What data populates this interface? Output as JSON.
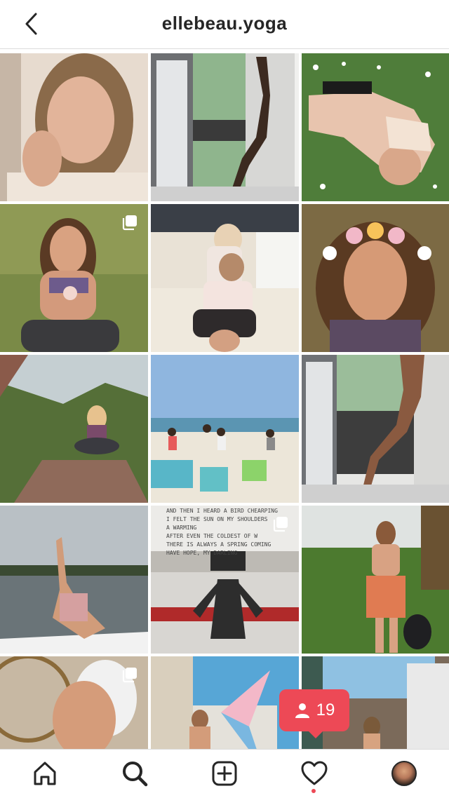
{
  "header": {
    "title": "ellebeau.yoga"
  },
  "posts": [
    {
      "desc": "portrait",
      "multi": false
    },
    {
      "desc": "yoga pose by window",
      "multi": false
    },
    {
      "desc": "lying on grass",
      "multi": false
    },
    {
      "desc": "sitting in grass",
      "multi": true
    },
    {
      "desc": "family yoga",
      "multi": false
    },
    {
      "desc": "flower crown portrait",
      "multi": false
    },
    {
      "desc": "meditating on rock",
      "multi": false
    },
    {
      "desc": "beach gathering",
      "multi": false
    },
    {
      "desc": "balcony pose",
      "multi": false
    },
    {
      "desc": "boat yoga",
      "multi": false
    },
    {
      "desc": "typewriter poem",
      "multi": true
    },
    {
      "desc": "garden with dog",
      "multi": false
    },
    {
      "desc": "white feathers",
      "multi": true
    },
    {
      "desc": "flag",
      "multi": false
    },
    {
      "desc": "outdoor shower",
      "multi": false
    }
  ],
  "typewriter_text": [
    "AND THEN I HEARD A BIRD CHEARPING",
    "I FELT THE SUN ON MY SHOULDERS",
    "A WARMING",
    "AFTER EVEN THE COLDEST OF W",
    "THERE IS ALWAYS A SPRING COMING",
    "HAVE HOPE, MY DARLING"
  ],
  "notification": {
    "count": "19",
    "icon": "person-icon"
  },
  "tabs": [
    {
      "name": "home",
      "icon": "home-icon"
    },
    {
      "name": "search",
      "icon": "search-icon"
    },
    {
      "name": "new-post",
      "icon": "plus-square-icon"
    },
    {
      "name": "activity",
      "icon": "heart-icon"
    },
    {
      "name": "profile",
      "icon": "avatar"
    }
  ]
}
